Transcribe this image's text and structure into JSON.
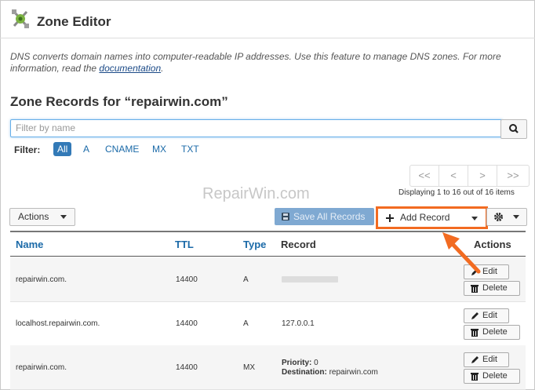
{
  "header": {
    "title": "Zone Editor",
    "logo_icon": "zone-editor-logo-icon"
  },
  "description": {
    "text": "DNS converts domain names into computer-readable IP addresses. Use this feature to manage DNS zones. For more information, read the ",
    "link_text": "documentation",
    "suffix": "."
  },
  "zone": {
    "title": "Zone Records for “repairwin.com”"
  },
  "search": {
    "placeholder": "Filter by name",
    "icon": "search-icon"
  },
  "filter": {
    "label": "Filter:",
    "options": [
      "All",
      "A",
      "CNAME",
      "MX",
      "TXT"
    ],
    "active": "All"
  },
  "pagination": {
    "first": "<<",
    "prev": "<",
    "next": ">",
    "last": ">>",
    "displaying": "Displaying 1 to 16 out of 16 items"
  },
  "watermark": "RepairWin.com",
  "toolbar": {
    "actions_label": "Actions",
    "save_label": "Save All Records",
    "add_label": "Add Record",
    "highlight_color": "#f26b21"
  },
  "table": {
    "headers": {
      "name": "Name",
      "ttl": "TTL",
      "type": "Type",
      "record": "Record",
      "actions": "Actions"
    },
    "rows": [
      {
        "name": "repairwin.com.",
        "ttl": "14400",
        "type": "A",
        "record": "",
        "record_blurred": true,
        "edit": "Edit",
        "delete": "Delete"
      },
      {
        "name": "localhost.repairwin.com.",
        "ttl": "14400",
        "type": "A",
        "record": "127.0.0.1",
        "edit": "Edit",
        "delete": "Delete"
      },
      {
        "name": "repairwin.com.",
        "ttl": "14400",
        "type": "MX",
        "priority_label": "Priority:",
        "priority": "0",
        "destination_label": "Destination:",
        "destination": "repairwin.com",
        "edit": "Edit",
        "delete": "Delete"
      }
    ]
  },
  "colors": {
    "link": "#1b6aa8",
    "primary": "#337ab7",
    "save_disabled": "#7fa9d2"
  }
}
